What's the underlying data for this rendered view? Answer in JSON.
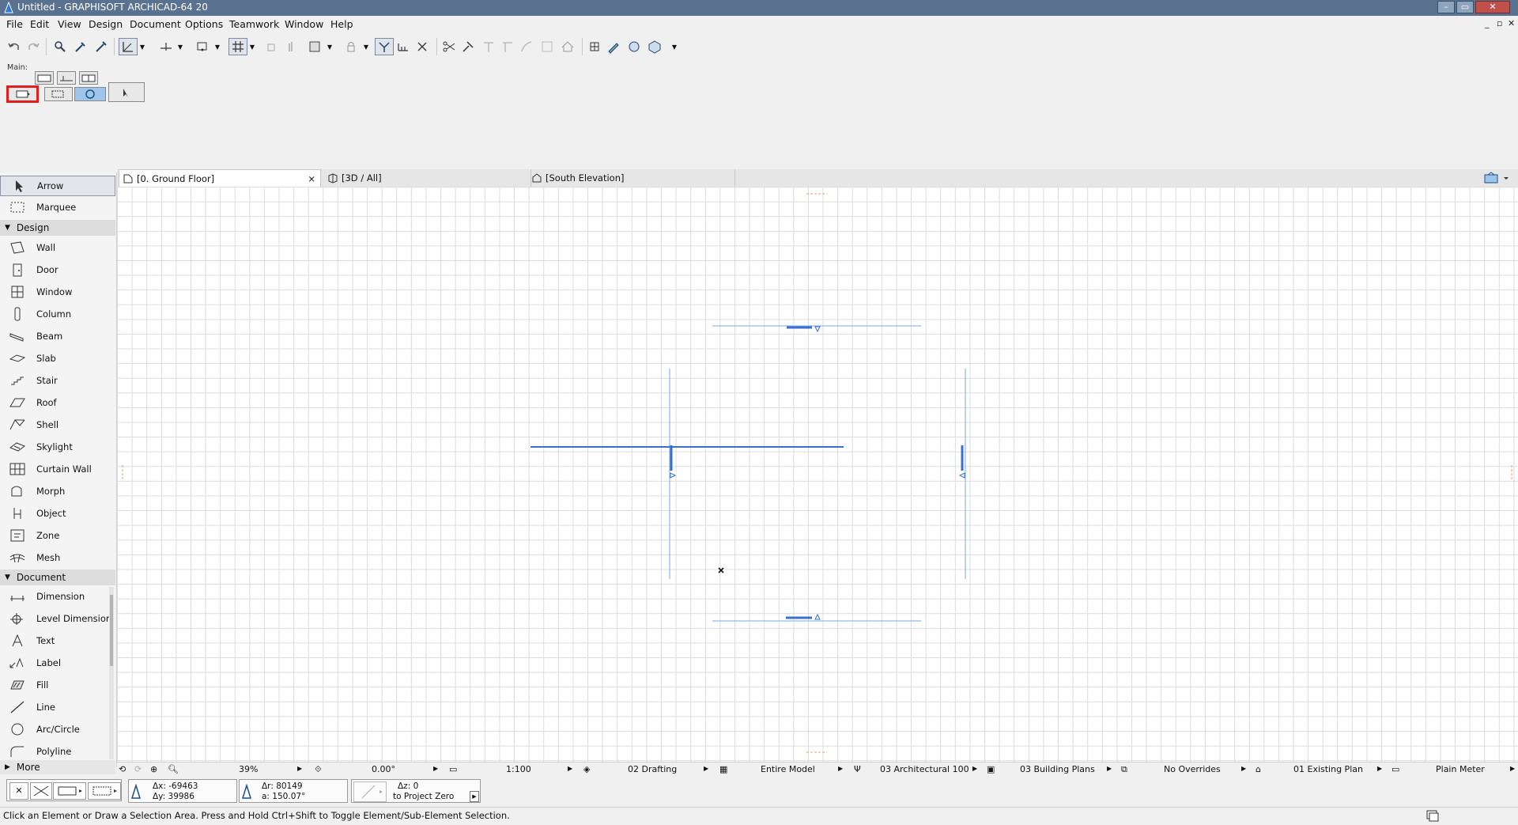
{
  "window": {
    "title": "Untitled - GRAPHISOFT ARCHICAD-64 20",
    "min_glyph": "–",
    "max_glyph": "▭",
    "close_glyph": "✕",
    "mdi_min": "_",
    "mdi_restore": "▫",
    "mdi_close": "✕"
  },
  "menu": [
    "File",
    "Edit",
    "View",
    "Design",
    "Document",
    "Options",
    "Teamwork",
    "Window",
    "Help"
  ],
  "palette": {
    "main_label": "Main:"
  },
  "toolbox": {
    "top_tools": [
      "Arrow",
      "Marquee"
    ],
    "design_group": "Design",
    "design_tools": [
      "Wall",
      "Door",
      "Window",
      "Column",
      "Beam",
      "Slab",
      "Stair",
      "Roof",
      "Shell",
      "Skylight",
      "Curtain Wall",
      "Morph",
      "Object",
      "Zone",
      "Mesh"
    ],
    "document_group": "Document",
    "document_tools": [
      "Dimension",
      "Level Dimension",
      "Text",
      "Label",
      "Fill",
      "Line",
      "Arc/Circle",
      "Polyline"
    ],
    "more_label": "More"
  },
  "tabs": [
    {
      "label": "[0. Ground Floor]",
      "close": "×"
    },
    {
      "label": "[3D / All]"
    },
    {
      "label": "[South Elevation]"
    }
  ],
  "quick_options": {
    "zoom": "39%",
    "angle": "0.00°",
    "scale": "1:100",
    "layer_combo": "02 Drafting",
    "model_view": "Entire Model",
    "pen_set": "03 Architectural 100",
    "mvo": "03 Building Plans",
    "overrides": "No Overrides",
    "renovation": "01 Existing Plan",
    "dimension": "Plain Meter"
  },
  "coords": {
    "dx": "Δx: -69463",
    "dy": "Δy: 39986",
    "dr": "Δr: 80149",
    "da": "a: 150.07°",
    "dz": "Δz: 0",
    "ref": "to Project Zero"
  },
  "status": "Click an Element or Draw a Selection Area. Press and Hold Ctrl+Shift to Toggle Element/Sub-Element Selection.",
  "colors": {
    "titlebar": "#5a7290",
    "element_blue": "#3a6fd0",
    "marker_orange": "#e8a070",
    "highlight_red": "#e0201c"
  }
}
